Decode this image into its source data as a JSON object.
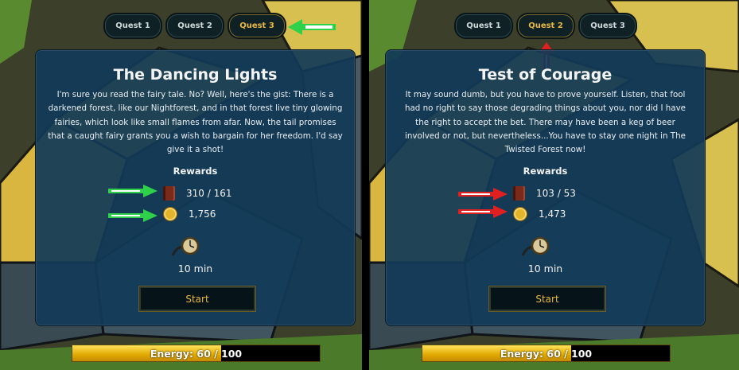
{
  "left": {
    "tabs": [
      "Quest 1",
      "Quest 2",
      "Quest 3"
    ],
    "active_tab": 2,
    "title": "The Dancing Lights",
    "description": "I'm sure you read the fairy tale. No? Well, here's the gist: There is a darkened forest, like our Nightforest, and in that forest live tiny glowing fairies, which look like small flames from afar. Now, the tail promises that a caught fairy grants you a wish to bargain for her freedom. I'd say give it a shot!",
    "rewards_title": "Rewards",
    "reward_xp": "310 / 161",
    "reward_gold": "1,756",
    "duration": "10 min",
    "start_label": "Start",
    "energy_label": "Energy: 60 / 100",
    "energy_value": 60,
    "energy_max": 100,
    "arrow_color": "#2fd04a"
  },
  "right": {
    "tabs": [
      "Quest 1",
      "Quest 2",
      "Quest 3"
    ],
    "active_tab": 1,
    "title": "Test of Courage",
    "description": "It may sound dumb, but you have to prove yourself. Listen, that fool had no right to say those degrading things about you, nor did I have the right to accept the bet. There may have been a keg of beer involved or not, but nevertheless...You have to stay one night in The Twisted Forest now!",
    "rewards_title": "Rewards",
    "reward_xp": "103 / 53",
    "reward_gold": "1,473",
    "duration": "10 min",
    "start_label": "Start",
    "energy_label": "Energy: 60 / 100",
    "energy_value": 60,
    "energy_max": 100,
    "arrow_color": "#e02020"
  },
  "colors": {
    "card_bg": "#123a58",
    "tab_active_text": "#e8b840",
    "energy_fill": "#f0c000"
  },
  "icons": {
    "xp": "book-icon",
    "gold": "coin-icon",
    "duration": "pocket-watch-icon"
  }
}
